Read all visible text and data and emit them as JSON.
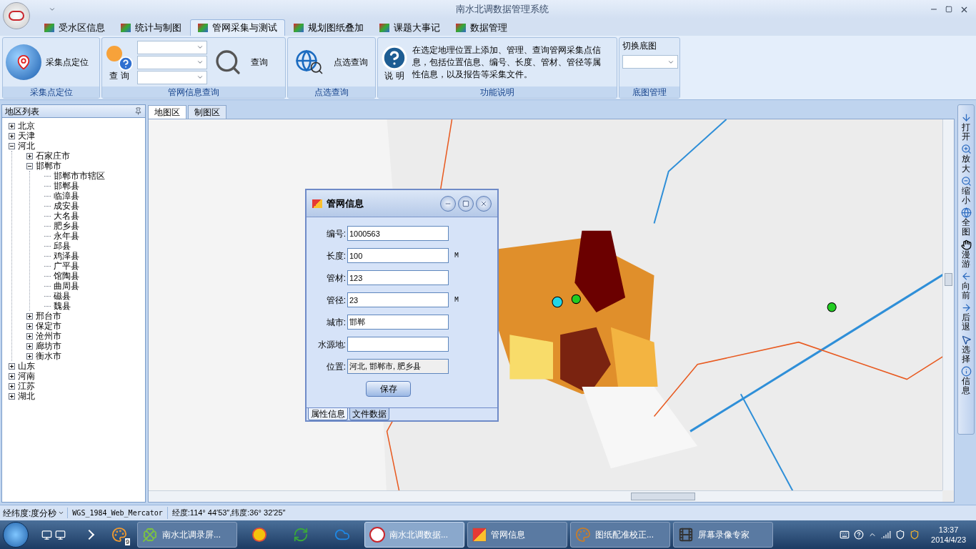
{
  "window": {
    "title": "南水北调数据管理系统"
  },
  "ribbon_tabs": [
    {
      "label": "受水区信息",
      "selected": false
    },
    {
      "label": "统计与制图",
      "selected": false
    },
    {
      "label": "管网采集与测试",
      "selected": true
    },
    {
      "label": "规划图纸叠加",
      "selected": false
    },
    {
      "label": "课题大事记",
      "selected": false
    },
    {
      "label": "数据管理",
      "selected": false
    }
  ],
  "ribbon": {
    "locate": {
      "button": "采集点定位",
      "group": "采集点定位"
    },
    "query": {
      "left_button": "查 询",
      "button": "查询",
      "group": "管网信息查询"
    },
    "point": {
      "button": "点选查询",
      "group": "点选查询"
    },
    "help": {
      "button": "说 明",
      "text": "在选定地理位置上添加、管理、查询管网采集点信息，包括位置信息、编号、长度、管材、管径等属性信息，以及报告等采集文件。",
      "group": "功能说明"
    },
    "basemap": {
      "label": "切换底图",
      "group": "底图管理"
    }
  },
  "region_panel": {
    "title": "地区列表",
    "tree": [
      {
        "label": "北京",
        "expanded": false
      },
      {
        "label": "天津",
        "expanded": false
      },
      {
        "label": "河北",
        "expanded": true,
        "children": [
          {
            "label": "石家庄市",
            "expanded": false
          },
          {
            "label": "邯郸市",
            "expanded": true,
            "children": [
              {
                "label": "邯郸市市辖区"
              },
              {
                "label": "邯郸县"
              },
              {
                "label": "临漳县"
              },
              {
                "label": "成安县"
              },
              {
                "label": "大名县"
              },
              {
                "label": "肥乡县"
              },
              {
                "label": "永年县"
              },
              {
                "label": "邱县"
              },
              {
                "label": "鸡泽县"
              },
              {
                "label": "广平县"
              },
              {
                "label": "馆陶县"
              },
              {
                "label": "曲周县"
              },
              {
                "label": "磁县"
              },
              {
                "label": "魏县"
              }
            ]
          },
          {
            "label": "邢台市",
            "expanded": false
          },
          {
            "label": "保定市",
            "expanded": false
          },
          {
            "label": "沧州市",
            "expanded": false
          },
          {
            "label": "廊坊市",
            "expanded": false
          },
          {
            "label": "衡水市",
            "expanded": false
          }
        ]
      },
      {
        "label": "山东",
        "expanded": false
      },
      {
        "label": "河南",
        "expanded": false
      },
      {
        "label": "江苏",
        "expanded": false
      },
      {
        "label": "湖北",
        "expanded": false
      }
    ]
  },
  "map_tabs": [
    {
      "label": "地图区",
      "selected": true
    },
    {
      "label": "制图区",
      "selected": false
    }
  ],
  "map_tools": [
    {
      "kind": "open",
      "label": "打开"
    },
    {
      "kind": "zoom_in",
      "label": "放大"
    },
    {
      "kind": "zoom_out",
      "label": "缩小"
    },
    {
      "kind": "full",
      "label": "全图"
    },
    {
      "kind": "pan",
      "label": "漫游"
    },
    {
      "kind": "forward",
      "label": "向前"
    },
    {
      "kind": "back",
      "label": "后退"
    },
    {
      "kind": "select",
      "label": "选择"
    },
    {
      "kind": "info",
      "label": "信息"
    }
  ],
  "dialog": {
    "title": "管网信息",
    "fields": [
      {
        "label": "编号:",
        "value": "1000563",
        "disabled": false
      },
      {
        "label": "长度:",
        "value": "100",
        "unit": "M",
        "disabled": false
      },
      {
        "label": "管材:",
        "value": "123",
        "disabled": false
      },
      {
        "label": "管径:",
        "value": "23",
        "unit": "M",
        "disabled": false
      },
      {
        "label": "城市:",
        "value": "邯郸",
        "disabled": false
      },
      {
        "label": "水源地:",
        "disabled": false
      },
      {
        "label": "位置:",
        "value": "河北, 邯郸市, 肥乡县",
        "disabled": true
      }
    ],
    "button": "保存",
    "tabs": [
      {
        "label": "属性信息",
        "selected": true
      },
      {
        "label": "文件数据",
        "selected": false
      }
    ]
  },
  "status_bar": {
    "unit": "经纬度:度分秒",
    "projection": "WGS_1984_Web_Mercator",
    "coordinates": "经度:114° 44′53″,纬度:36° 32′25″"
  },
  "taskbar": {
    "apps": [
      {
        "kind": "clover",
        "label": "南水北调录屏...",
        "selected": false
      },
      {
        "kind": "chrome",
        "selected": false
      },
      {
        "kind": "refresh",
        "selected": false
      },
      {
        "kind": "cloud",
        "selected": false
      },
      {
        "kind": "logo",
        "label": "南水北调数据...",
        "selected": true
      },
      {
        "kind": "window",
        "label": "管网信息",
        "selected": false
      },
      {
        "kind": "palette",
        "label": "图纸配准校正...",
        "selected": false
      },
      {
        "kind": "film",
        "label": "屏幕录像专家",
        "selected": false
      }
    ],
    "badge": "9",
    "time": "13:37",
    "date": "2014/4/23"
  }
}
